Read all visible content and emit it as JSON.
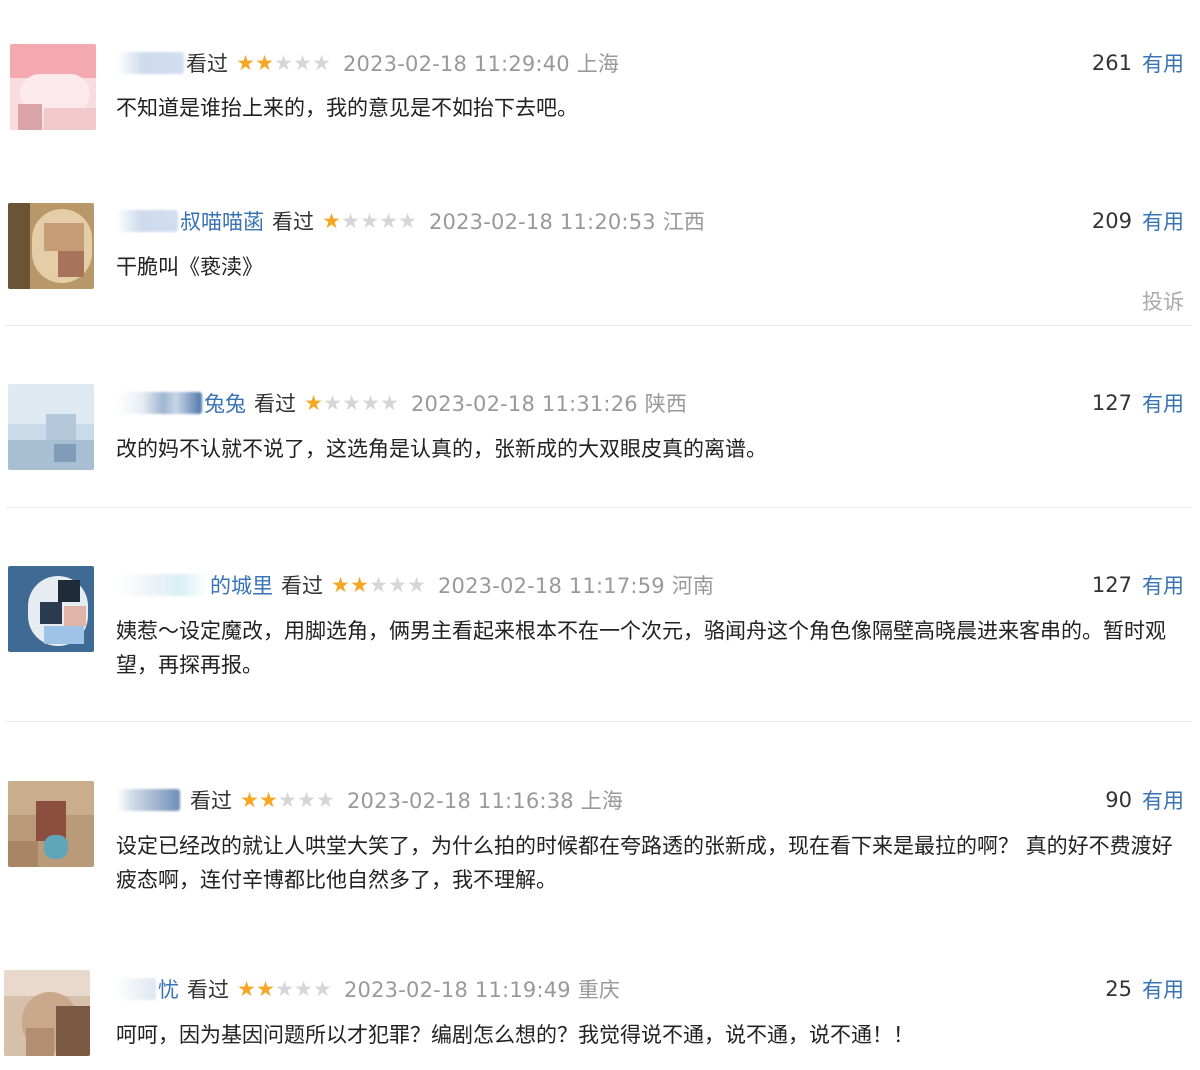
{
  "reviews": [
    {
      "username": "",
      "watched": "看过",
      "rating": 2,
      "time": "2023-02-18 11:29:40 上海",
      "useful_count": "261",
      "useful_label": "有用",
      "text": "不知道是谁抬上来的，我的意见是不如抬下去吧。"
    },
    {
      "username": "叔喵喵菡",
      "watched": "看过",
      "rating": 1,
      "time": "2023-02-18 11:20:53 江西",
      "useful_count": "209",
      "useful_label": "有用",
      "text": "干脆叫《亵渎》",
      "report": "投诉"
    },
    {
      "username": "兔兔",
      "watched": "看过",
      "rating": 1,
      "time": "2023-02-18 11:31:26 陕西",
      "useful_count": "127",
      "useful_label": "有用",
      "text": "改的妈不认就不说了，这选角是认真的，张新成的大双眼皮真的离谱。"
    },
    {
      "username": "的城里",
      "watched": "看过",
      "rating": 2,
      "time": "2023-02-18 11:17:59 河南",
      "useful_count": "127",
      "useful_label": "有用",
      "text": "姨惹～设定魔改，用脚选角，俩男主看起来根本不在一个次元，骆闻舟这个角色像隔壁高晓晨进来客串的。暂时观望，再探再报。"
    },
    {
      "username": "",
      "watched": "看过",
      "rating": 2,
      "time": "2023-02-18 11:16:38 上海",
      "useful_count": "90",
      "useful_label": "有用",
      "text": "设定已经改的就让人哄堂大笑了，为什么拍的时候都在夸路透的张新成，现在看下来是最拉的啊？ 真的好不费渡好疲态啊，连付辛博都比他自然多了，我不理解。"
    },
    {
      "username": "忧",
      "watched": "看过",
      "rating": 2,
      "time": "2023-02-18 11:19:49 重庆",
      "useful_count": "25",
      "useful_label": "有用",
      "text": "呵呵，因为基因问题所以才犯罪？编剧怎么想的？我觉得说不通，说不通，说不通！！"
    }
  ],
  "colors": {
    "username": "#3773b5",
    "useful_label": "#3773b5",
    "star_on": "#f5a623",
    "star_off": "#d6d6d6",
    "time": "#999999"
  },
  "icons": {
    "star": "star-icon",
    "avatar": "blurred-avatar"
  }
}
